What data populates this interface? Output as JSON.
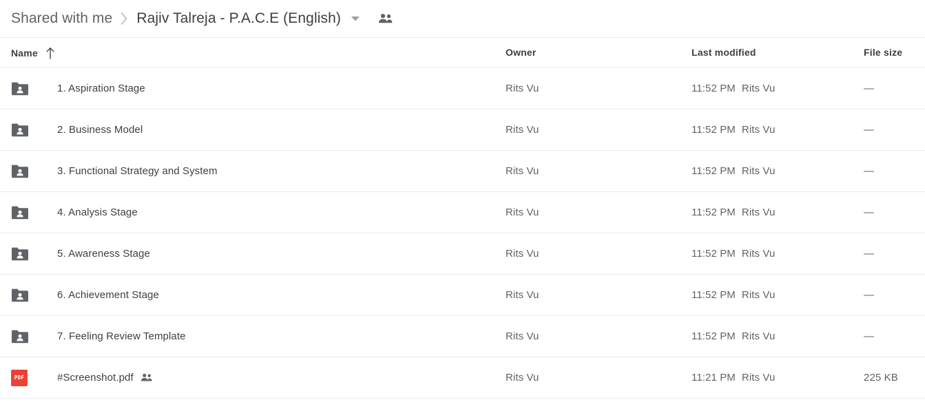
{
  "breadcrumb": {
    "parent": "Shared with me",
    "separator_icon": "chevron-right-icon",
    "current": "Rajiv Talreja - P.A.C.E (English)",
    "caret_icon": "chevron-down-icon",
    "people_icon": "people-icon"
  },
  "columns": {
    "name": "Name",
    "owner": "Owner",
    "last_modified": "Last modified",
    "file_size": "File size",
    "sort_icon": "arrow-up-icon"
  },
  "colors": {
    "pdf_red": "#ea4335",
    "folder_gray": "#5f6368",
    "divider": "#e8eaed",
    "text_primary": "#3c4043",
    "text_secondary": "#5f6368"
  },
  "rows": [
    {
      "icon": "shared-folder-icon",
      "type": "folder",
      "name": "1. Aspiration Stage",
      "shared_badge": false,
      "owner": "Rits Vu",
      "modified_time": "11:52 PM",
      "modified_by": "Rits Vu",
      "size": "—"
    },
    {
      "icon": "shared-folder-icon",
      "type": "folder",
      "name": "2. Business Model",
      "shared_badge": false,
      "owner": "Rits Vu",
      "modified_time": "11:52 PM",
      "modified_by": "Rits Vu",
      "size": "—"
    },
    {
      "icon": "shared-folder-icon",
      "type": "folder",
      "name": "3. Functional Strategy and System",
      "shared_badge": false,
      "owner": "Rits Vu",
      "modified_time": "11:52 PM",
      "modified_by": "Rits Vu",
      "size": "—"
    },
    {
      "icon": "shared-folder-icon",
      "type": "folder",
      "name": "4. Analysis Stage",
      "shared_badge": false,
      "owner": "Rits Vu",
      "modified_time": "11:52 PM",
      "modified_by": "Rits Vu",
      "size": "—"
    },
    {
      "icon": "shared-folder-icon",
      "type": "folder",
      "name": "5. Awareness Stage",
      "shared_badge": false,
      "owner": "Rits Vu",
      "modified_time": "11:52 PM",
      "modified_by": "Rits Vu",
      "size": "—"
    },
    {
      "icon": "shared-folder-icon",
      "type": "folder",
      "name": "6. Achievement Stage",
      "shared_badge": false,
      "owner": "Rits Vu",
      "modified_time": "11:52 PM",
      "modified_by": "Rits Vu",
      "size": "—"
    },
    {
      "icon": "shared-folder-icon",
      "type": "folder",
      "name": "7. Feeling Review Template",
      "shared_badge": false,
      "owner": "Rits Vu",
      "modified_time": "11:52 PM",
      "modified_by": "Rits Vu",
      "size": "—"
    },
    {
      "icon": "pdf-file-icon",
      "type": "pdf",
      "name": "#Screenshot.pdf",
      "shared_badge": true,
      "badge_icon": "people-icon",
      "owner": "Rits Vu",
      "modified_time": "11:21 PM",
      "modified_by": "Rits Vu",
      "size": "225 KB",
      "pdf_label": "PDF"
    }
  ]
}
